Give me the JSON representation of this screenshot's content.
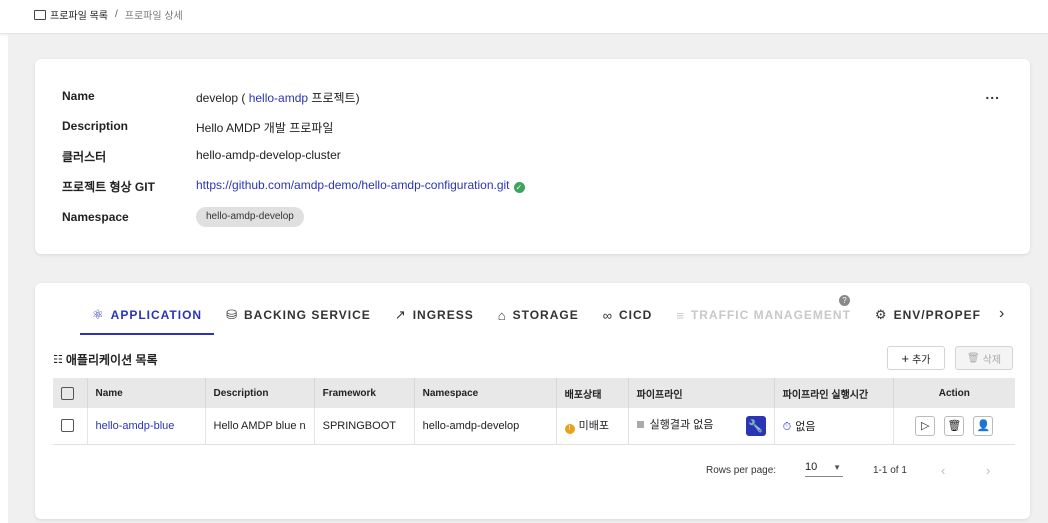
{
  "breadcrumb": {
    "parent": "프로파일 목록",
    "separator": "/",
    "current": "프로파일 상세"
  },
  "info": {
    "rows": [
      {
        "label": "Name",
        "value": ""
      },
      {
        "label": "Description",
        "value": "Hello AMDP 개발 프로파일"
      },
      {
        "label": "클러스터",
        "value": "hello-amdp-develop-cluster"
      },
      {
        "label": "프로젝트 형상 GIT",
        "value": "https://github.com/amdp-demo/hello-amdp-configuration.git"
      },
      {
        "label": "Namespace",
        "value": "hello-amdp-develop"
      }
    ],
    "name_prefix": "develop ( ",
    "name_project": "hello-amdp",
    "name_suffix": " 프로젝트)",
    "more_label": "..."
  },
  "tabs": [
    {
      "label": "APPLICATION",
      "icon": "atom-icon",
      "glyph": "⚛"
    },
    {
      "label": "BACKING SERVICE",
      "icon": "database-icon",
      "glyph": "⛁"
    },
    {
      "label": "INGRESS",
      "icon": "external-link-icon",
      "glyph": "↗"
    },
    {
      "label": "STORAGE",
      "icon": "storage-icon",
      "glyph": "⌂"
    },
    {
      "label": "CICD",
      "icon": "infinity-icon",
      "glyph": "∞"
    },
    {
      "label": "TRAFFIC MANAGEMENT",
      "icon": "traffic-icon",
      "glyph": "≡"
    },
    {
      "label": "ENV/PROPEF",
      "icon": "gear-icon",
      "glyph": "⚙"
    }
  ],
  "list": {
    "title": "애플리케이션 목록",
    "add_label": "추가",
    "delete_label": "삭제",
    "columns": [
      "Name",
      "Description",
      "Framework",
      "Namespace",
      "배포상태",
      "파이프라인",
      "파이프라인 실행시간",
      "Action"
    ],
    "rows": [
      {
        "name": "hello-amdp-blue",
        "description": "Hello AMDP blue n",
        "framework": "SPRINGBOOT",
        "namespace": "hello-amdp-develop",
        "deploy_status": "미배포",
        "pipeline": "실행결과 없음",
        "pipeline_time": "없음"
      }
    ]
  },
  "pagination": {
    "rows_per_page_label": "Rows per page:",
    "rows_per_page": "10",
    "range": "1-1 of 1"
  },
  "colors": {
    "accent": "#2a34b5",
    "success": "#3aa55b",
    "warning": "#e6a21b"
  }
}
